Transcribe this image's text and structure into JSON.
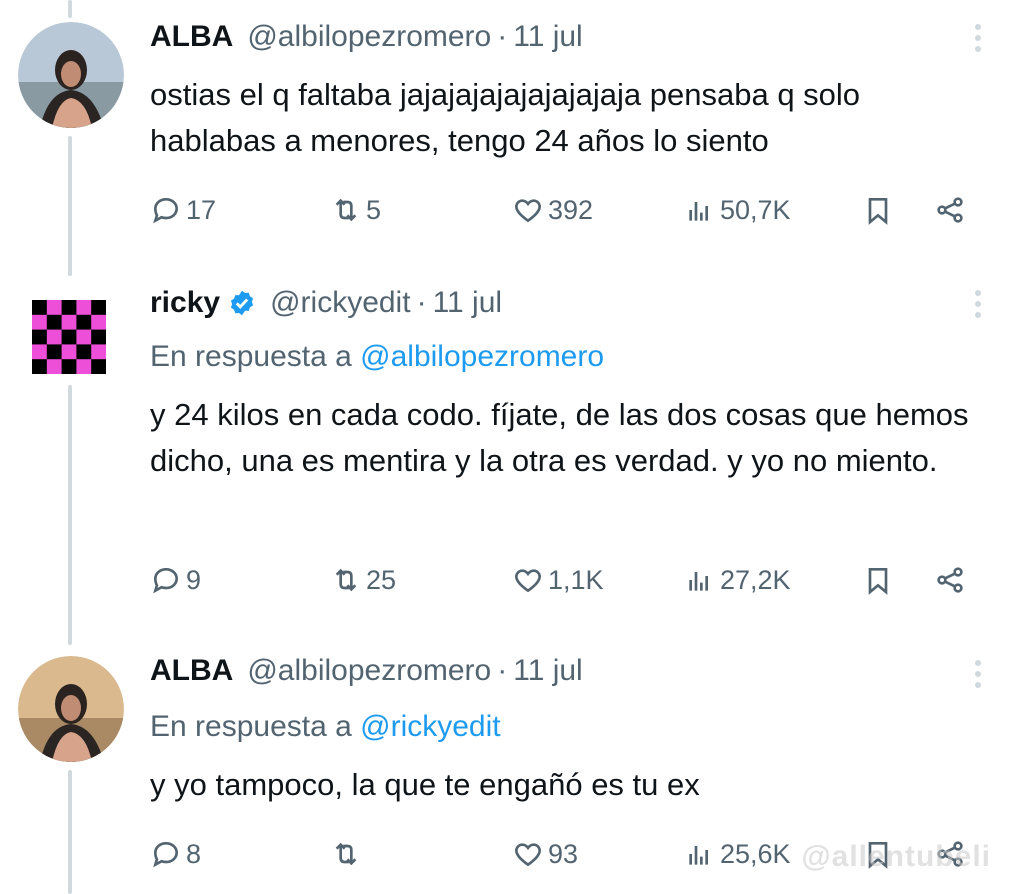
{
  "tweets": [
    {
      "name": "ALBA",
      "handle": "@albilopezromero",
      "separator": "·",
      "date": "11 jul",
      "reply_prefix": "",
      "reply_mention": "",
      "text": "ostias el q faltaba jajajajajajajajajaja pensaba q solo hablabas a menores, tengo 24 años lo siento",
      "replies": "17",
      "retweets": "5",
      "likes": "392",
      "views": "50,7K"
    },
    {
      "name": "ricky",
      "handle": "@rickyedit",
      "separator": "·",
      "date": "11 jul",
      "reply_prefix": "En respuesta a",
      "reply_mention": "@albilopezromero",
      "text": "y 24 kilos en cada codo. fíjate, de las dos cosas que hemos dicho, una es mentira y la otra es verdad. y yo no miento.",
      "replies": "9",
      "retweets": "25",
      "likes": "1,1K",
      "views": "27,2K"
    },
    {
      "name": "ALBA",
      "handle": "@albilopezromero",
      "separator": "·",
      "date": "11 jul",
      "reply_prefix": "En respuesta a",
      "reply_mention": "@rickyedit",
      "text": "y yo tampoco, la que te engañó es tu ex",
      "replies": "8",
      "retweets": "",
      "likes": "93",
      "views": "25,6K"
    }
  ],
  "watermark": "@allentubeli",
  "colors": {
    "accent": "#1d9bf0",
    "muted": "#536471",
    "thread": "#cfd9de",
    "checker_pink": "#ee4fd8"
  },
  "icons": [
    "reply-icon",
    "retweet-icon",
    "like-icon",
    "views-icon",
    "bookmark-icon",
    "share-icon",
    "verified-badge-icon",
    "more-icon"
  ]
}
